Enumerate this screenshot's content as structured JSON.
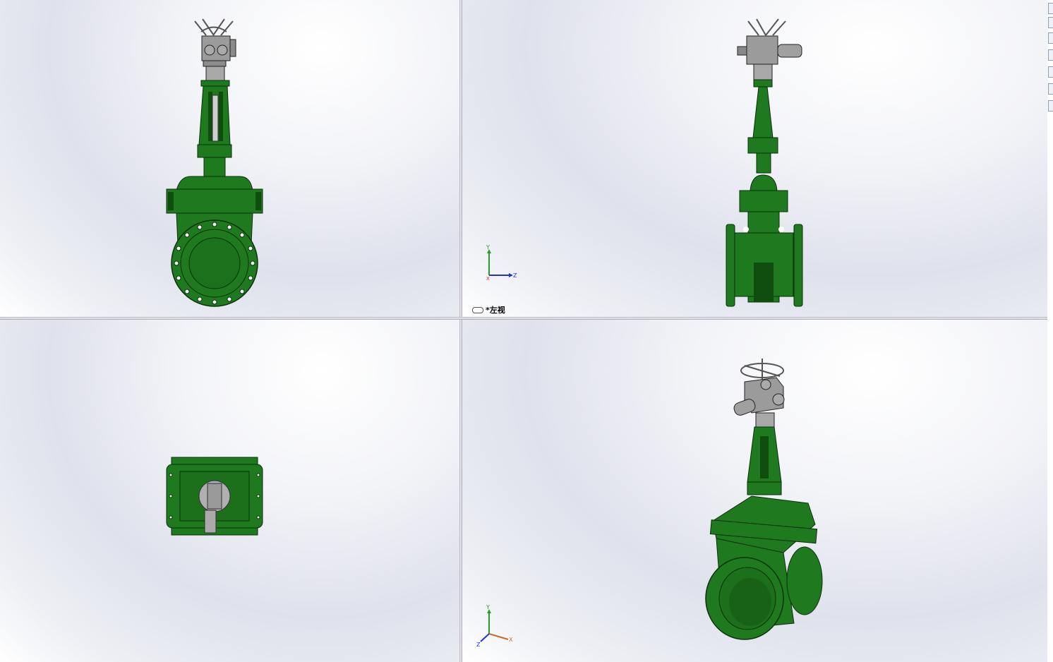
{
  "window": {
    "layout": "four-viewport"
  },
  "viewports": {
    "front": {
      "name": "front-view"
    },
    "left": {
      "name": "left-view",
      "label": "*左视"
    },
    "top": {
      "name": "top-view"
    },
    "iso": {
      "name": "isometric-view"
    }
  },
  "triad_left": {
    "y": "Y",
    "z": "Z",
    "x": "X"
  },
  "triad_iso": {
    "y": "Y",
    "z": "Z",
    "x": "X"
  },
  "colors": {
    "body": "#1f7a1f",
    "body_dark": "#0f4d0f",
    "actuator": "#9a9a9a",
    "axis_y": "#2a9a2a",
    "axis_z": "#2233cc",
    "axis_x": "#cc6a22"
  },
  "side_toolbar": {
    "icons": [
      "pin-icon",
      "view-icon",
      "display-icon",
      "cube-icon",
      "appearance-icon",
      "scene-icon",
      "camera-icon"
    ]
  }
}
